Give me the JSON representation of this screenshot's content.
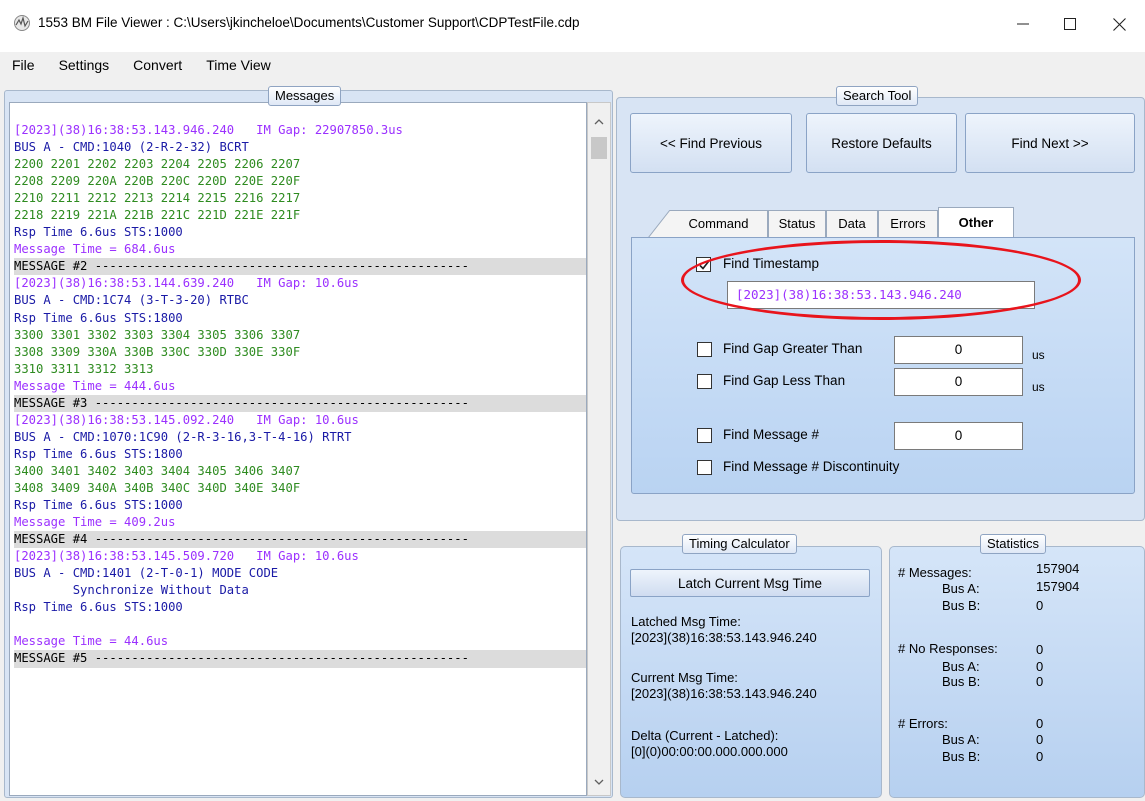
{
  "window": {
    "title": "1553 BM File Viewer : C:\\Users\\jkincheloe\\Documents\\Customer Support\\CDPTestFile.cdp",
    "minimize": "—",
    "maximize": "☐",
    "close": "✕"
  },
  "menu": [
    "File",
    "Settings",
    "Convert",
    "Time View"
  ],
  "messages": {
    "title": "Messages",
    "lines": [
      {
        "text": "[2023](38)16:38:53.143.946.240   IM Gap: 22907850.3us",
        "color": "purple"
      },
      {
        "text": "BUS A - CMD:1040 (2-R-2-32) BCRT",
        "color": "blue"
      },
      {
        "text": "2200 2201 2202 2203 2204 2205 2206 2207",
        "color": "green"
      },
      {
        "text": "2208 2209 220A 220B 220C 220D 220E 220F",
        "color": "green"
      },
      {
        "text": "2210 2211 2212 2213 2214 2215 2216 2217",
        "color": "green"
      },
      {
        "text": "2218 2219 221A 221B 221C 221D 221E 221F",
        "color": "green"
      },
      {
        "text": "Rsp Time 6.6us STS:1000",
        "color": "blue"
      },
      {
        "text": "Message Time = 684.6us",
        "color": "purple"
      },
      {
        "text": "MESSAGE #2 ---------------------------------------------------",
        "color": "sep"
      },
      {
        "text": "[2023](38)16:38:53.144.639.240   IM Gap: 10.6us",
        "color": "purple"
      },
      {
        "text": "BUS A - CMD:1C74 (3-T-3-20) RTBC",
        "color": "blue"
      },
      {
        "text": "Rsp Time 6.6us STS:1800",
        "color": "blue"
      },
      {
        "text": "3300 3301 3302 3303 3304 3305 3306 3307",
        "color": "green"
      },
      {
        "text": "3308 3309 330A 330B 330C 330D 330E 330F",
        "color": "green"
      },
      {
        "text": "3310 3311 3312 3313",
        "color": "green"
      },
      {
        "text": "Message Time = 444.6us",
        "color": "purple"
      },
      {
        "text": "MESSAGE #3 ---------------------------------------------------",
        "color": "sep"
      },
      {
        "text": "[2023](38)16:38:53.145.092.240   IM Gap: 10.6us",
        "color": "purple"
      },
      {
        "text": "BUS A - CMD:1070:1C90 (2-R-3-16,3-T-4-16) RTRT",
        "color": "blue"
      },
      {
        "text": "Rsp Time 6.6us STS:1800",
        "color": "blue"
      },
      {
        "text": "3400 3401 3402 3403 3404 3405 3406 3407",
        "color": "green"
      },
      {
        "text": "3408 3409 340A 340B 340C 340D 340E 340F",
        "color": "green"
      },
      {
        "text": "Rsp Time 6.6us STS:1000",
        "color": "blue"
      },
      {
        "text": "Message Time = 409.2us",
        "color": "purple"
      },
      {
        "text": "MESSAGE #4 ---------------------------------------------------",
        "color": "sep"
      },
      {
        "text": "[2023](38)16:38:53.145.509.720   IM Gap: 10.6us",
        "color": "purple"
      },
      {
        "text": "BUS A - CMD:1401 (2-T-0-1) MODE CODE",
        "color": "blue"
      },
      {
        "text": "        Synchronize Without Data",
        "color": "blue"
      },
      {
        "text": "Rsp Time 6.6us STS:1000",
        "color": "blue"
      },
      {
        "text": "",
        "color": "blue"
      },
      {
        "text": "Message Time = 44.6us",
        "color": "purple"
      },
      {
        "text": "MESSAGE #5 ---------------------------------------------------",
        "color": "sep"
      }
    ]
  },
  "colors": {
    "purple": "#9b30ff",
    "blue": "#1a1aa6",
    "green": "#2e8b20",
    "highlight_oval": "#e8141c"
  },
  "search_tool": {
    "title": "Search Tool",
    "find_previous": "<< Find Previous",
    "restore_defaults": "Restore Defaults",
    "find_next": "Find Next >>",
    "tabs": [
      "Command",
      "Status",
      "Data",
      "Errors",
      "Other"
    ],
    "active_tab": "Other",
    "find_timestamp": {
      "label": "Find Timestamp",
      "checked": true,
      "value": "[2023](38)16:38:53.143.946.240"
    },
    "gap_greater": {
      "label": "Find Gap Greater Than",
      "checked": false,
      "value": "0",
      "unit": "us"
    },
    "gap_less": {
      "label": "Find Gap Less Than",
      "checked": false,
      "value": "0",
      "unit": "us"
    },
    "message_num": {
      "label": "Find Message #",
      "checked": false,
      "value": "0"
    },
    "discontinuity": {
      "label": "Find Message # Discontinuity",
      "checked": false
    }
  },
  "timing": {
    "title": "Timing Calculator",
    "latch_button": "Latch Current Msg Time",
    "latched_label": "Latched Msg Time:",
    "latched_value": "[2023](38)16:38:53.143.946.240",
    "current_label": "Current Msg Time:",
    "current_value": "[2023](38)16:38:53.143.946.240",
    "delta_label": "Delta (Current - Latched):",
    "delta_value": "[0](0)00:00:00.000.000.000"
  },
  "statistics": {
    "title": "Statistics",
    "messages_label": "# Messages:",
    "messages_value": "157904",
    "msg_bus_a_label": "Bus A:",
    "msg_bus_a_value": "157904",
    "msg_bus_b_label": "Bus B:",
    "msg_bus_b_value": "0",
    "noresp_label": "# No Responses:",
    "noresp_value": "0",
    "noresp_bus_a_label": "Bus A:",
    "noresp_bus_a_value": "0",
    "noresp_bus_b_label": "Bus B:",
    "noresp_bus_b_value": "0",
    "errors_label": "# Errors:",
    "errors_value": "0",
    "err_bus_a_label": "Bus A:",
    "err_bus_a_value": "0",
    "err_bus_b_label": "Bus B:",
    "err_bus_b_value": "0"
  }
}
